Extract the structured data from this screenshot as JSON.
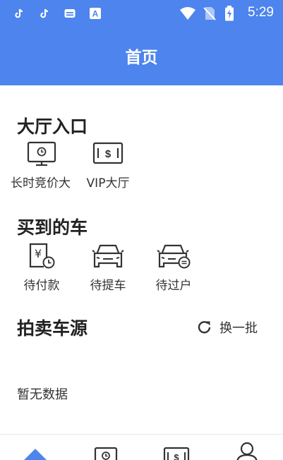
{
  "status_bar": {
    "time": "5:29",
    "icons": [
      "tiktok-icon",
      "tiktok-icon",
      "app-icon",
      "font-app-icon",
      "wifi-icon",
      "no-sim-icon",
      "battery-charging-icon"
    ]
  },
  "header": {
    "title": "首页"
  },
  "hall_section": {
    "title": "大厅入口",
    "items": [
      {
        "label": "长时竞价大",
        "icon": "timed-auction-icon"
      },
      {
        "label": "VIP大厅",
        "icon": "vip-hall-icon"
      }
    ]
  },
  "cars_section": {
    "title": "买到的车",
    "items": [
      {
        "label": "待付款",
        "icon": "pending-payment-icon"
      },
      {
        "label": "待提车",
        "icon": "pending-pickup-icon"
      },
      {
        "label": "待过户",
        "icon": "pending-transfer-icon"
      }
    ]
  },
  "auction_section": {
    "title": "拍卖车源",
    "refresh_label": "换一批",
    "empty_text": "暂无数据"
  },
  "tabbar": {
    "tabs": [
      "home-tab-icon",
      "auction-tab-icon",
      "vip-tab-icon",
      "profile-tab-icon"
    ]
  },
  "colors": {
    "primary": "#4D84ED",
    "text": "#333333",
    "icon": "#333333"
  }
}
